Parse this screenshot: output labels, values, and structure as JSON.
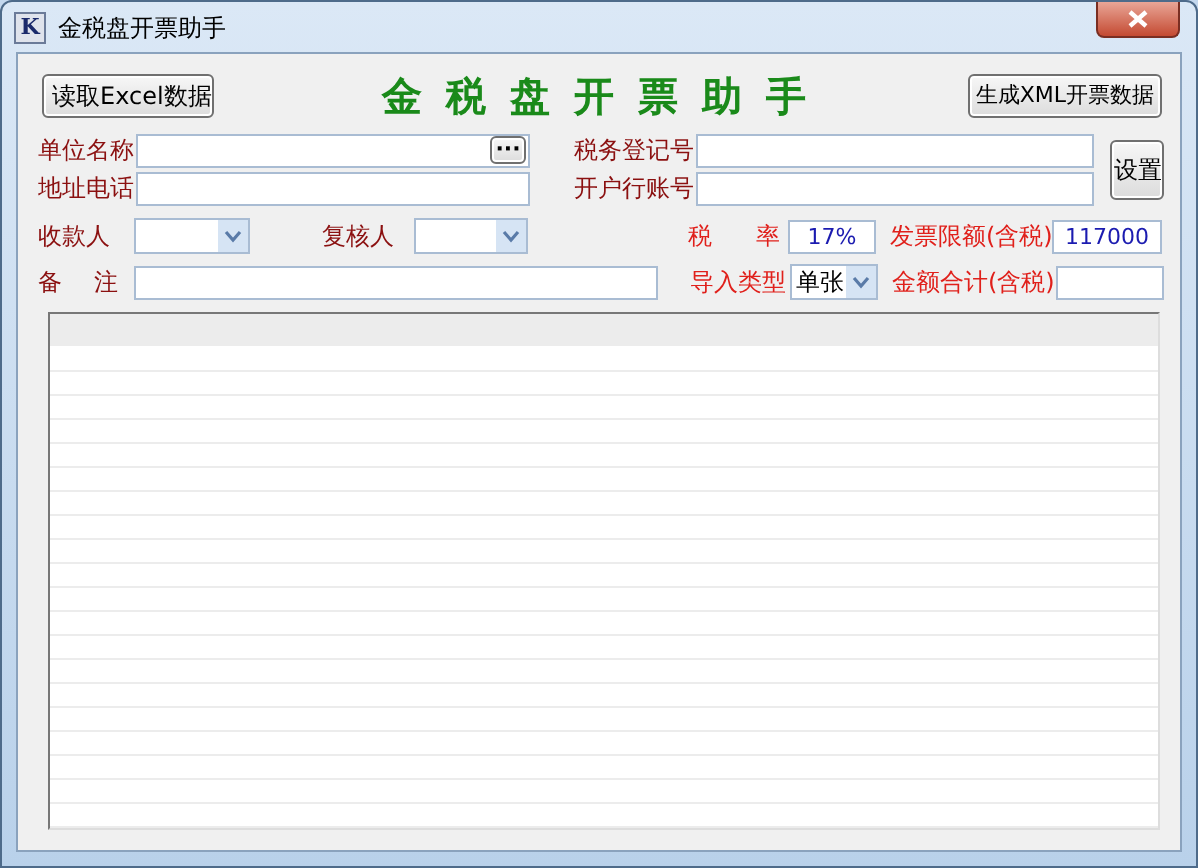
{
  "window": {
    "icon_letter": "K",
    "title": "金税盘开票助手"
  },
  "header": {
    "import_button": "读取Excel数据",
    "heading": "金税盘开票助手",
    "export_button": "生成XML开票数据"
  },
  "form": {
    "company_name": {
      "label": "单位名称",
      "browse_button": "···"
    },
    "tax_id": {
      "label": "税务登记号"
    },
    "address_phone": {
      "label": "地址电话"
    },
    "bank_account": {
      "label": "开户行账号"
    },
    "settings_button": "设置",
    "payee": {
      "label": "收款人"
    },
    "reviewer": {
      "label": "复核人"
    },
    "tax_rate": {
      "label": "税 率",
      "value": "17%"
    },
    "invoice_limit": {
      "label": "发票限额(含税)",
      "value": "117000"
    },
    "remarks": {
      "label": "备 注"
    },
    "import_type": {
      "label": "导入类型",
      "value": "单张"
    },
    "total": {
      "label": "金额合计(含税)"
    }
  }
}
